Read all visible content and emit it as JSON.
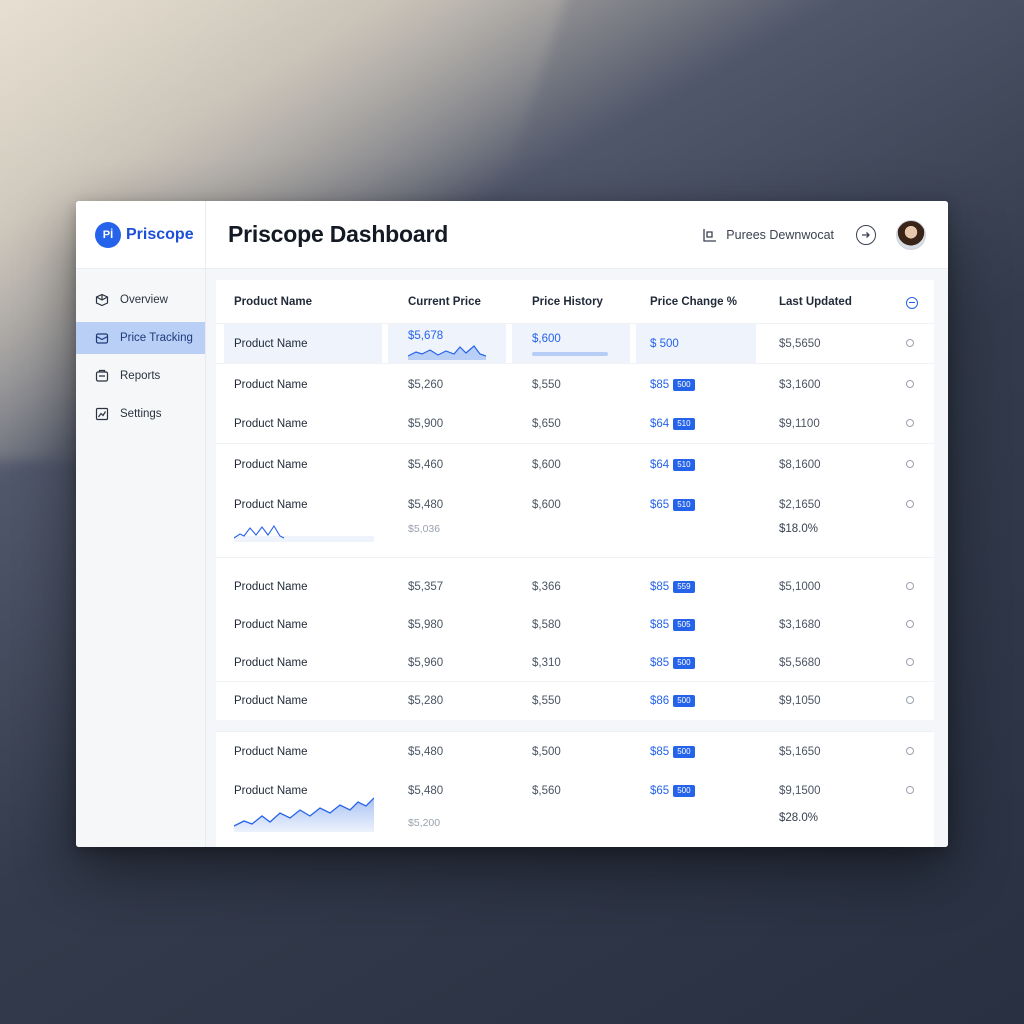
{
  "brand": {
    "logo": "Pİ",
    "name": "Priscope"
  },
  "sidebar": {
    "items": [
      {
        "label": "Overview",
        "icon": "box-icon",
        "active": false
      },
      {
        "label": "Price Tracking",
        "icon": "tag-icon",
        "active": true
      },
      {
        "label": "Reports",
        "icon": "report-icon",
        "active": false
      },
      {
        "label": "Settings",
        "icon": "settings-icon",
        "active": false
      }
    ]
  },
  "header": {
    "title": "Priscope Dashboard",
    "workspace": "Purees Dewnwocat"
  },
  "table": {
    "columns": [
      "Product Name",
      "Current Price",
      "Price History",
      "Price Change %",
      "Last Updated"
    ],
    "rows": [
      {
        "name": "Product Name",
        "current": "$5,678",
        "history": "$,600",
        "change": "$ 500",
        "badge": "",
        "updated": "$5,5650"
      },
      {
        "name": "Product Name",
        "current": "$5,260",
        "history": "$,550",
        "change": "$85",
        "badge": "500",
        "updated": "$3,1600"
      },
      {
        "name": "Product Name",
        "current": "$5,900",
        "history": "$,650",
        "change": "$64",
        "badge": "510",
        "updated": "$9,1100"
      },
      {
        "name": "Product Name",
        "current": "$5,460",
        "history": "$,600",
        "change": "$64",
        "badge": "510",
        "updated": "$8,1600"
      },
      {
        "name": "Product Name",
        "current": "$5,480",
        "history": "$,600",
        "change": "$65",
        "badge": "510",
        "updated": "$2,1650",
        "sub_current": "$5,036",
        "sub_updated": "$18.0%"
      },
      {
        "name": "Product Name",
        "current": "$5,357",
        "history": "$,366",
        "change": "$85",
        "badge": "559",
        "updated": "$5,1000"
      },
      {
        "name": "Product Name",
        "current": "$5,980",
        "history": "$,580",
        "change": "$85",
        "badge": "505",
        "updated": "$3,1680"
      },
      {
        "name": "Product Name",
        "current": "$5,960",
        "history": "$,310",
        "change": "$85",
        "badge": "500",
        "updated": "$5,5680"
      },
      {
        "name": "Product Name",
        "current": "$5,280",
        "history": "$,550",
        "change": "$86",
        "badge": "500",
        "updated": "$9,1050"
      }
    ],
    "rows2": [
      {
        "name": "Product Name",
        "current": "$5,480",
        "history": "$,500",
        "change": "$85",
        "badge": "500",
        "updated": "$5,1650"
      },
      {
        "name": "Product Name",
        "current": "$5,480",
        "history": "$,560",
        "change": "$65",
        "badge": "500",
        "updated": "$9,1500",
        "sub_current": "$5,200",
        "sub_updated": "$28.0%"
      }
    ]
  },
  "colors": {
    "accent": "#2563eb",
    "active_nav": "#b9cff6"
  }
}
